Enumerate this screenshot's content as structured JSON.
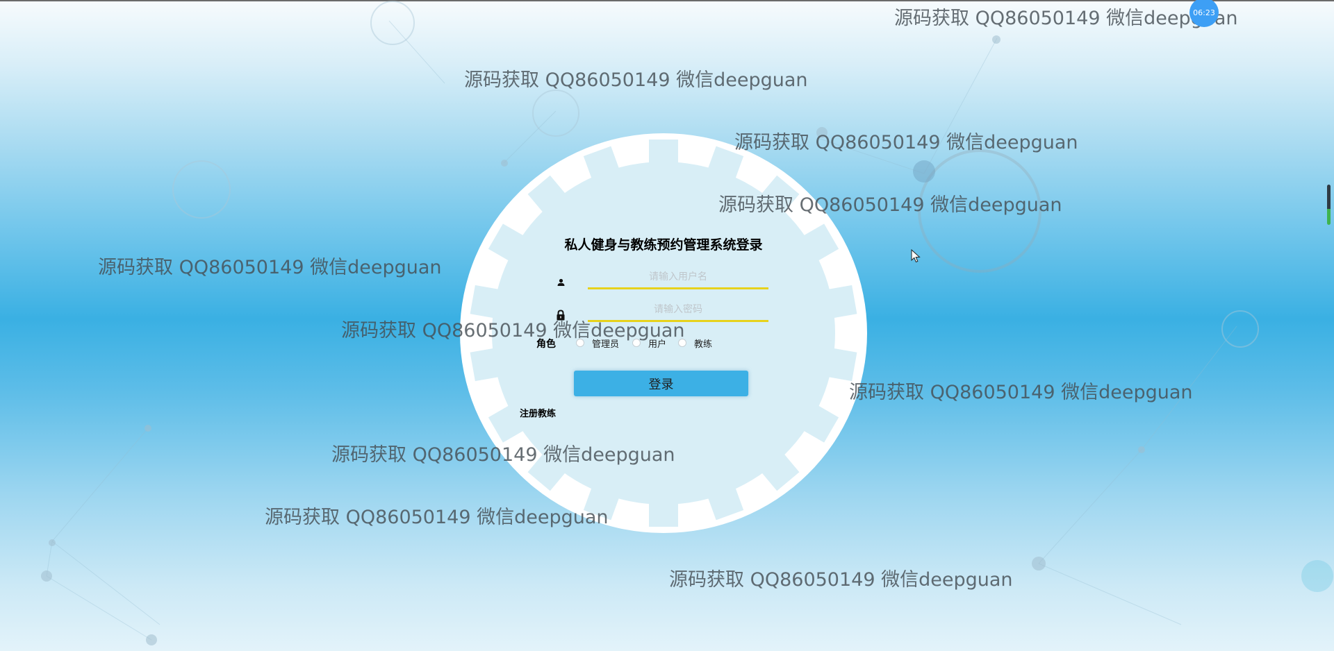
{
  "login": {
    "title": "私人健身与教练预约管理系统登录",
    "username_placeholder": "请输入用户名",
    "password_placeholder": "请输入密码",
    "role_label": "角色",
    "roles": [
      "管理员",
      "用户",
      "教练"
    ],
    "login_button": "登录",
    "register_link": "注册教练"
  },
  "watermark": {
    "text": "源码获取 QQ86050149 微信deepguan"
  },
  "system": {
    "clock": "06:23"
  },
  "icons": {
    "user": "user-icon",
    "lock": "lock-icon",
    "cursor": "mouse-pointer-icon"
  },
  "colors": {
    "accent": "#3cb0e5",
    "input_underline": "#e7d21c",
    "clock_badge": "#3d9ff5"
  }
}
